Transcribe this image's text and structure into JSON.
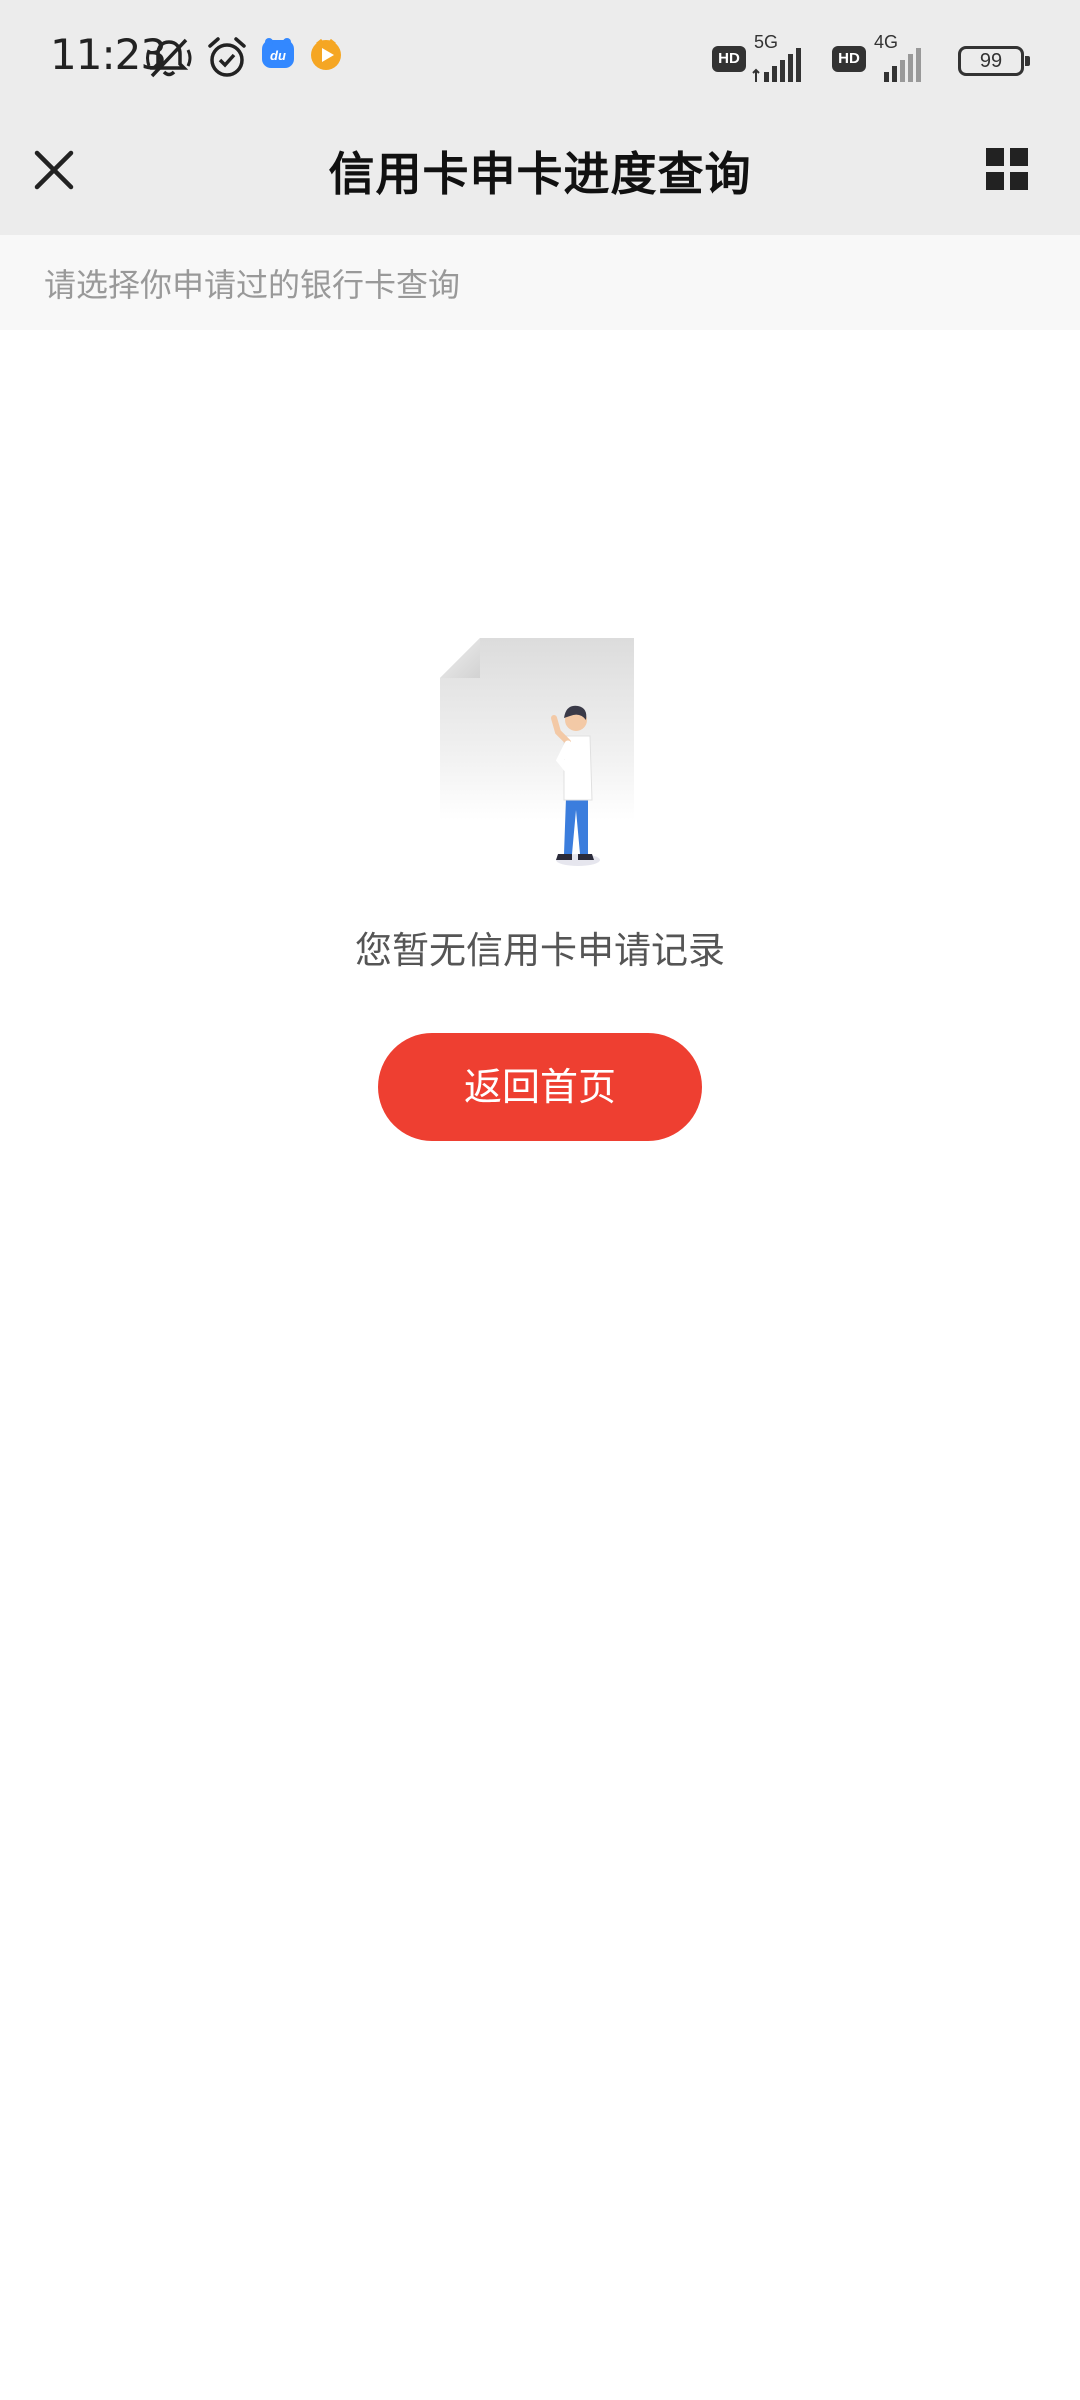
{
  "status_bar": {
    "time": "11:23",
    "icons_left": [
      "silent-vibrate-icon",
      "alarm-icon",
      "baidu-app-icon",
      "video-app-icon"
    ],
    "sim1": {
      "hd": "HD",
      "network": "5G"
    },
    "sim2": {
      "hd": "HD",
      "network": "4G"
    },
    "battery": "99"
  },
  "nav": {
    "title": "信用卡申卡进度查询",
    "close_icon": "close-icon",
    "more_icon": "grid-menu-icon"
  },
  "subheader": {
    "hint": "请选择你申请过的银行卡查询"
  },
  "empty_state": {
    "message": "您暂无信用卡申请记录",
    "button_label": "返回首页",
    "button_color": "#ee3f31"
  }
}
